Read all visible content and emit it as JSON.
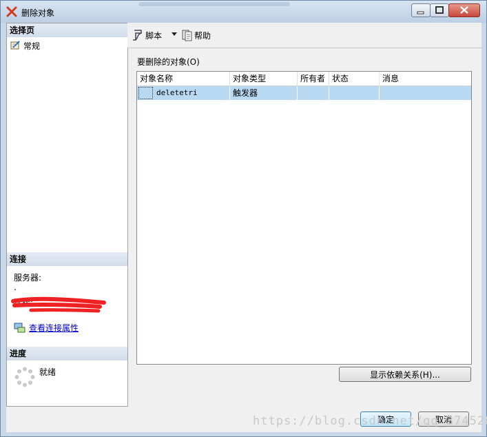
{
  "window": {
    "title": "删除对象"
  },
  "left_pane": {
    "pages_header": "选择页",
    "pages": [
      {
        "label": "常规"
      }
    ],
    "connection_header": "连接",
    "server_label": "服务器:",
    "server_value": ".",
    "connection_label": "连接:",
    "view_connection_properties": "查看连接属性",
    "progress_header": "进度",
    "progress_status": "就绪"
  },
  "toolbar": {
    "script_label": "脚本",
    "help_label": "帮助"
  },
  "main": {
    "objects_label": "要删除的对象(O)",
    "columns": [
      "对象名称",
      "对象类型",
      "所有者",
      "状态",
      "消息"
    ],
    "rows": [
      {
        "name": "deletetri",
        "type": "触发器",
        "owner": "",
        "status": "",
        "message": ""
      }
    ],
    "show_dependencies_button": "显示依赖关系(H)..."
  },
  "footer": {
    "ok_button": "确定",
    "cancel_button": "取消"
  },
  "watermark": "https://blog.csdn.net/qq_37452827"
}
